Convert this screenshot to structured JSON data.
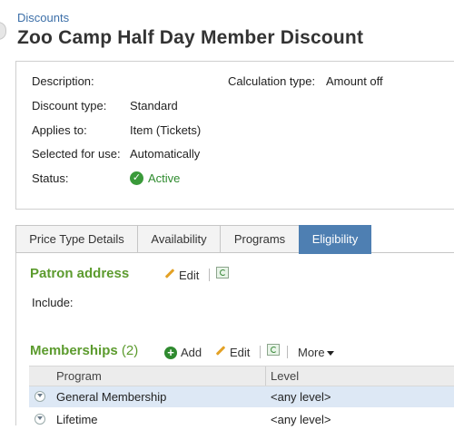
{
  "header": {
    "breadcrumb": "Discounts",
    "title": "Zoo Camp Half Day Member Discount"
  },
  "summary": {
    "description_label": "Description:",
    "description_value": "",
    "calculation_label": "Calculation type:",
    "calculation_value": "Amount off",
    "discount_type_label": "Discount type:",
    "discount_type_value": "Standard",
    "applies_to_label": "Applies to:",
    "applies_to_value": "Item (Tickets)",
    "selected_label": "Selected for use:",
    "selected_value": "Automatically",
    "status_label": "Status:",
    "status_value": "Active"
  },
  "tabs": [
    {
      "label": "Price Type Details"
    },
    {
      "label": "Availability"
    },
    {
      "label": "Programs"
    },
    {
      "label": "Eligibility"
    }
  ],
  "eligibility": {
    "patron_address": {
      "title": "Patron address",
      "edit_label": "Edit",
      "include_label": "Include:"
    },
    "memberships": {
      "title": "Memberships",
      "count": "(2)",
      "add_label": "Add",
      "edit_label": "Edit",
      "more_label": "More",
      "columns": [
        "Program",
        "Level"
      ],
      "rows": [
        {
          "program": "General Membership",
          "level": "<any level>"
        },
        {
          "program": "Lifetime",
          "level": "<any level>"
        }
      ]
    }
  },
  "colors": {
    "section_title": "#5c9b2e",
    "active_tab": "#4e7fb2",
    "link": "#3c6fa8",
    "status_active": "#2e8b2e"
  }
}
